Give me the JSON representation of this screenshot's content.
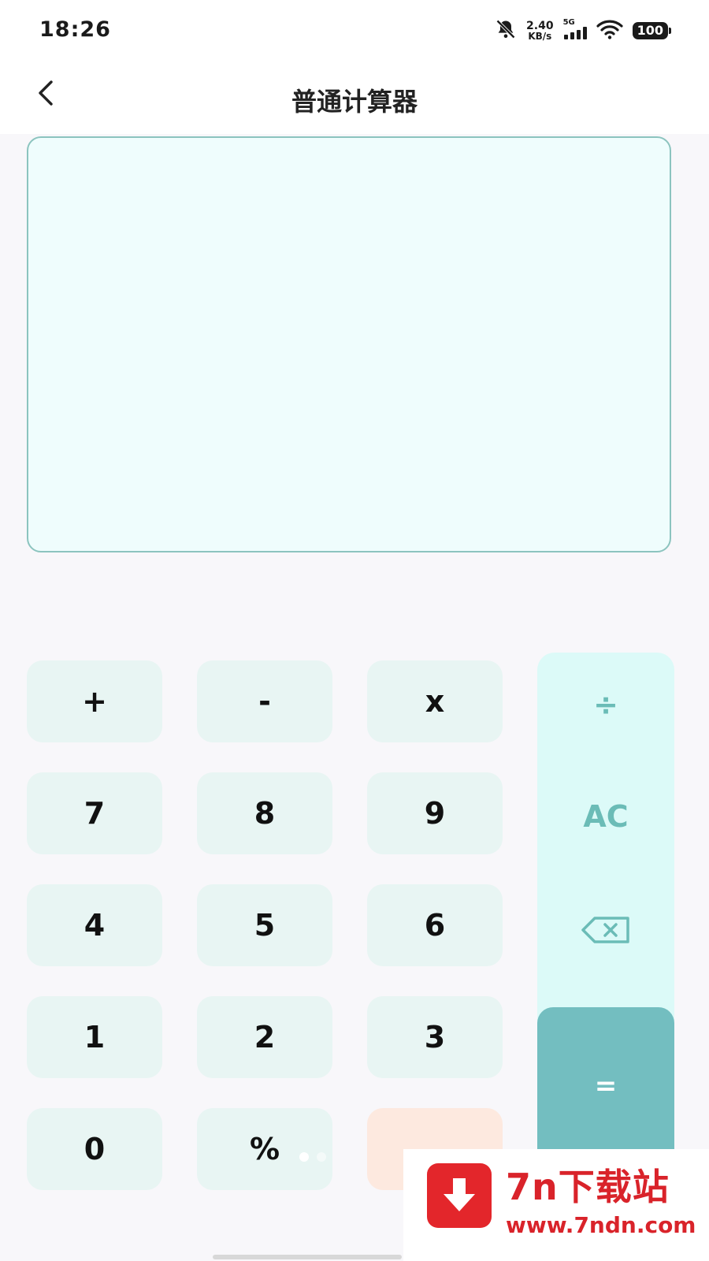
{
  "status_bar": {
    "time": "18:26",
    "net_speed_value": "2.40",
    "net_speed_unit": "KB/s",
    "network_type": "5G",
    "battery": "100",
    "icons": [
      "bell-muted-icon",
      "signal-icon",
      "wifi-icon",
      "battery-icon"
    ]
  },
  "header": {
    "title": "普通计算器",
    "back_icon": "chevron-left-icon"
  },
  "display": {
    "expression": "",
    "result": ""
  },
  "keypad": {
    "plus": "+",
    "minus": "-",
    "multiply": "x",
    "seven": "7",
    "eight": "8",
    "nine": "9",
    "four": "4",
    "five": "5",
    "six": "6",
    "one": "1",
    "two": "2",
    "three": "3",
    "zero": "0",
    "percent": "%",
    "divide": "÷",
    "clear": "AC",
    "backspace_icon": "backspace-icon",
    "equals": "="
  },
  "colors": {
    "accent": "#73bec0",
    "accent_light": "#dcfaf8",
    "key_bg": "#e8f5f3",
    "display_border": "#8cc4bf",
    "watermark_red": "#d9232a"
  },
  "watermark": {
    "name": "7n下载站",
    "url": "www.7ndn.com"
  }
}
